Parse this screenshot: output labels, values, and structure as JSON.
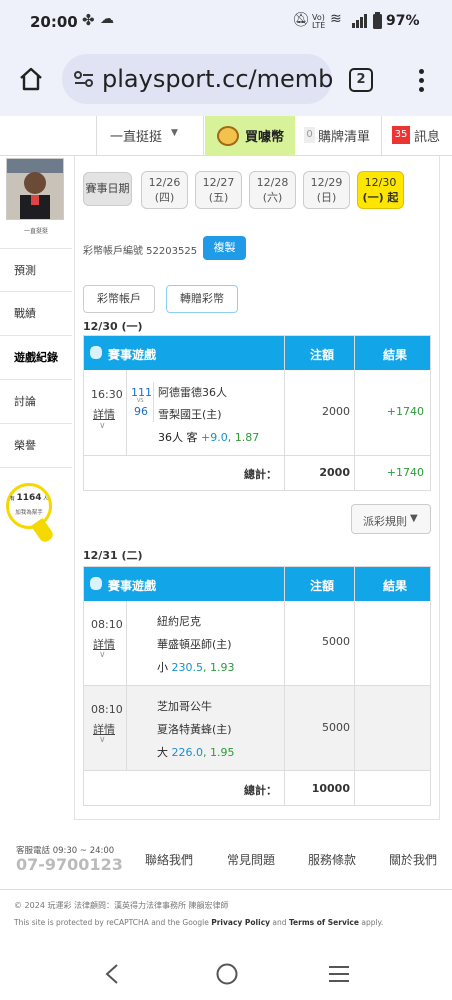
{
  "status": {
    "time": "20:00",
    "battery": "97%",
    "net": "Vo) LTE"
  },
  "browser": {
    "url": "playsport.cc/memb",
    "tab_count": "2"
  },
  "topnav": {
    "user": "一直挺挺",
    "buy": "買噱幣",
    "cart_count": "0",
    "cart": "購牌清單",
    "msg_count": "35",
    "msg": "訊息"
  },
  "sidebar": {
    "username": "一直挺挺",
    "items": [
      "預測",
      "戰績",
      "遊戲紀錄",
      "討論",
      "榮譽"
    ],
    "helper_prefix": "有",
    "helper_count": "1164",
    "helper_suffix": "人",
    "helper_text": "加我為幫手"
  },
  "dates": {
    "label": "賽事日期",
    "items": [
      {
        "date": "12/26",
        "day": "(四)"
      },
      {
        "date": "12/27",
        "day": "(五)"
      },
      {
        "date": "12/28",
        "day": "(六)"
      },
      {
        "date": "12/29",
        "day": "(日)"
      },
      {
        "date": "12/30",
        "day": "(一) 起"
      }
    ]
  },
  "account": {
    "label": "彩幣帳戶編號 52203525",
    "copy": "複製"
  },
  "tabs": {
    "wallet": "彩幣帳戶",
    "transfer": "轉贈彩幣"
  },
  "section1": {
    "date": "12/30 (一)",
    "headers": {
      "game": "賽事遊戲",
      "bet": "注額",
      "result": "結果"
    },
    "row": {
      "time": "16:30",
      "detail": "詳情",
      "away_no": "111",
      "vs": "VS",
      "home_no": "96",
      "away": "阿德雷德36人",
      "home": "雪梨國王(主)",
      "pick": "36人 客",
      "line": "+9.0",
      "odds": "1.87",
      "bet": "2000",
      "result": "+1740"
    },
    "total_label": "總計：",
    "total_bet": "2000",
    "total_result": "+1740"
  },
  "payout_rule": "派彩規則",
  "section2": {
    "date": "12/31 (二)",
    "headers": {
      "game": "賽事遊戲",
      "bet": "注額",
      "result": "結果"
    },
    "rows": [
      {
        "time": "08:10",
        "detail": "詳情",
        "away": "紐約尼克",
        "home": "華盛頓巫師(主)",
        "pick": "小",
        "line": "230.5",
        "odds": "1.93",
        "bet": "5000",
        "result": ""
      },
      {
        "time": "08:10",
        "detail": "詳情",
        "away": "芝加哥公牛",
        "home": "夏洛特黃蜂(主)",
        "pick": "大",
        "line": "226.0",
        "odds": "1.95",
        "bet": "5000",
        "result": ""
      }
    ],
    "total_label": "總計：",
    "total_bet": "10000"
  },
  "footer": {
    "hotline_label": "客服電話 09:30 ~ 24:00",
    "phone": "07-9700123",
    "links": [
      "聯絡我們",
      "常見問題",
      "服務條款",
      "關於我們"
    ],
    "copyright": "© 2024 玩運彩  法律顧問：漢英得力法律事務所 陳韻宏律師",
    "recaptcha_pre": "This site is protected by reCAPTCHA and the Google",
    "privacy": "Privacy Policy",
    "and": "and",
    "terms": "Terms of Service",
    "apply": "apply."
  },
  "colors": {
    "accent": "#12a5e8",
    "win": "#2b9a3a",
    "highlight": "#ffe600"
  }
}
